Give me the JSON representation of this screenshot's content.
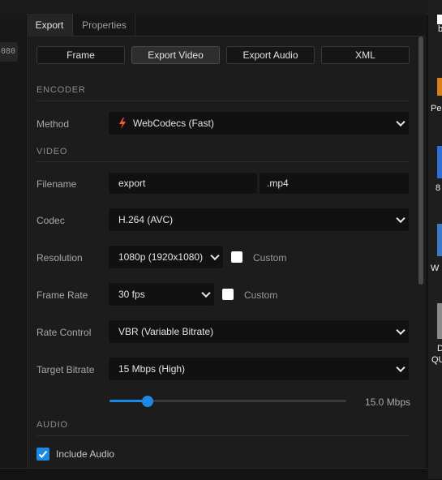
{
  "left_panel": {
    "badge": "080"
  },
  "panel_tabs": [
    {
      "label": "Export",
      "active": true
    },
    {
      "label": "Properties",
      "active": false
    }
  ],
  "export_tabs": [
    {
      "label": "Frame",
      "active": false
    },
    {
      "label": "Export Video",
      "active": true
    },
    {
      "label": "Export Audio",
      "active": false
    },
    {
      "label": "XML",
      "active": false
    }
  ],
  "encoder": {
    "section": "ENCODER",
    "method_label": "Method",
    "method_value": "WebCodecs (Fast)",
    "method_icon": "bolt-icon"
  },
  "video": {
    "section": "VIDEO",
    "filename_label": "Filename",
    "filename_value": "export",
    "extension": ".mp4",
    "codec_label": "Codec",
    "codec_value": "H.264 (AVC)",
    "resolution_label": "Resolution",
    "resolution_value": "1080p (1920x1080)",
    "resolution_custom": "Custom",
    "resolution_custom_checked": false,
    "framerate_label": "Frame Rate",
    "framerate_value": "30 fps",
    "framerate_custom": "Custom",
    "framerate_custom_checked": false,
    "ratecontrol_label": "Rate Control",
    "ratecontrol_value": "VBR (Variable Bitrate)",
    "bitrate_label": "Target Bitrate",
    "bitrate_value": "15 Mbps (High)",
    "bitrate_slider_fraction": 0.16,
    "bitrate_readout": "15.0 Mbps"
  },
  "audio": {
    "section": "AUDIO",
    "include_label": "Include Audio",
    "include_checked": true
  },
  "desktop": {
    "fragments": [
      "b",
      "Pe",
      "8",
      "W",
      "D",
      "QU"
    ]
  },
  "colors": {
    "accent": "#1e88e5",
    "bolt": "#ff5a36",
    "panel": "#1c1c1c",
    "field": "#111111"
  }
}
